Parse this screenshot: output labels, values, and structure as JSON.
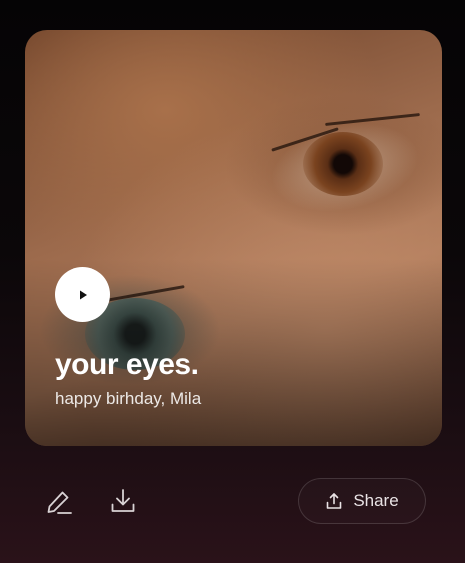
{
  "card": {
    "title": "your eyes.",
    "subtitle": "happy birhday, Mila",
    "play_icon": "play-icon"
  },
  "actions": {
    "edit_icon": "pencil-icon",
    "download_icon": "download-icon",
    "share_icon": "share-icon",
    "share_label": "Share"
  },
  "colors": {
    "text_primary": "#ffffff",
    "icon": "#d8d2d4",
    "background_bottom": "#2a1219"
  }
}
